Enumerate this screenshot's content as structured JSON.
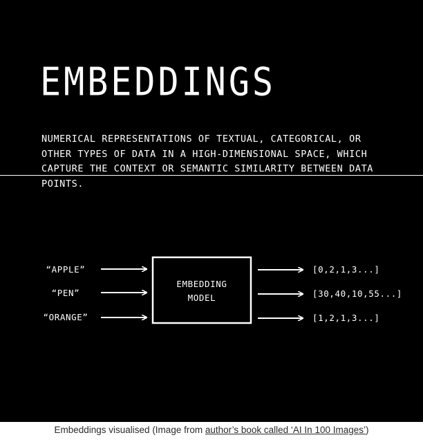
{
  "title": "EMBEDDINGS",
  "description_lines": [
    "NUMERICAL REPRESENTATIONS OF TEXTUAL, CATEGORICAL, OR",
    "OTHER TYPES OF DATA IN A HIGH-DIMENSIONAL SPACE, WHICH",
    "CAPTURE THE CONTEXT OR SEMANTIC SIMILARITY BETWEEN DATA",
    "POINTS."
  ],
  "diagram": {
    "inputs": [
      "“APPLE”",
      "“PEN”",
      "“ORANGE”"
    ],
    "model_lines": [
      "EMBEDDING",
      "MODEL"
    ],
    "outputs": [
      "[0,2,1,3...]",
      "[30,40,10,55...]",
      "[1,2,1,3...]"
    ]
  },
  "caption": {
    "prefix": "Embeddings visualised (Image from ",
    "link": "author’s book called ‘AI In 100 Images’",
    "suffix": ")"
  },
  "colors": {
    "background": "#000000",
    "foreground": "#ffffff",
    "caption_text": "#2b2b2b"
  }
}
